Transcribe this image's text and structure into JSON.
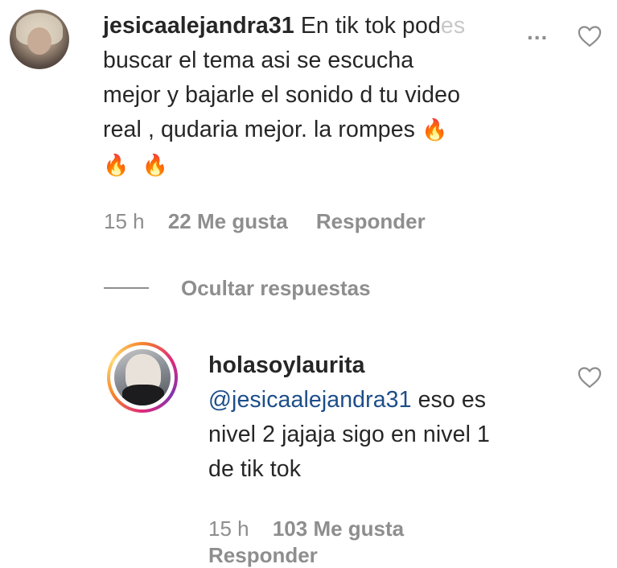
{
  "comment_1": {
    "username": "jesicaalejandra31",
    "line1_text": "En tik tok pod",
    "line1_faded": "es",
    "more_dots": "...",
    "line2": "buscar el tema asi se escucha",
    "line3": "mejor y bajarle el sonido d tu video",
    "line4": "real , qudaria mejor. la rompes",
    "emoji": "🔥",
    "time": "15 h",
    "likes": "22 Me gusta",
    "reply": "Responder",
    "heart_icon": "heart-outline"
  },
  "hide_replies": {
    "label": "Ocultar respuestas"
  },
  "reply_1": {
    "username": "holasoylaurita",
    "mention": "@jesicaalejandra31",
    "line1_rest": " eso es",
    "line2": "nivel 2 jajaja sigo en nivel 1",
    "line3": "de tik tok",
    "time": "15 h",
    "likes": "103 Me gusta",
    "reply": "Responder",
    "heart_icon": "heart-outline",
    "story_ring_colors": [
      "#f58529",
      "#dd2a7b",
      "#8134af",
      "#feda77"
    ]
  }
}
